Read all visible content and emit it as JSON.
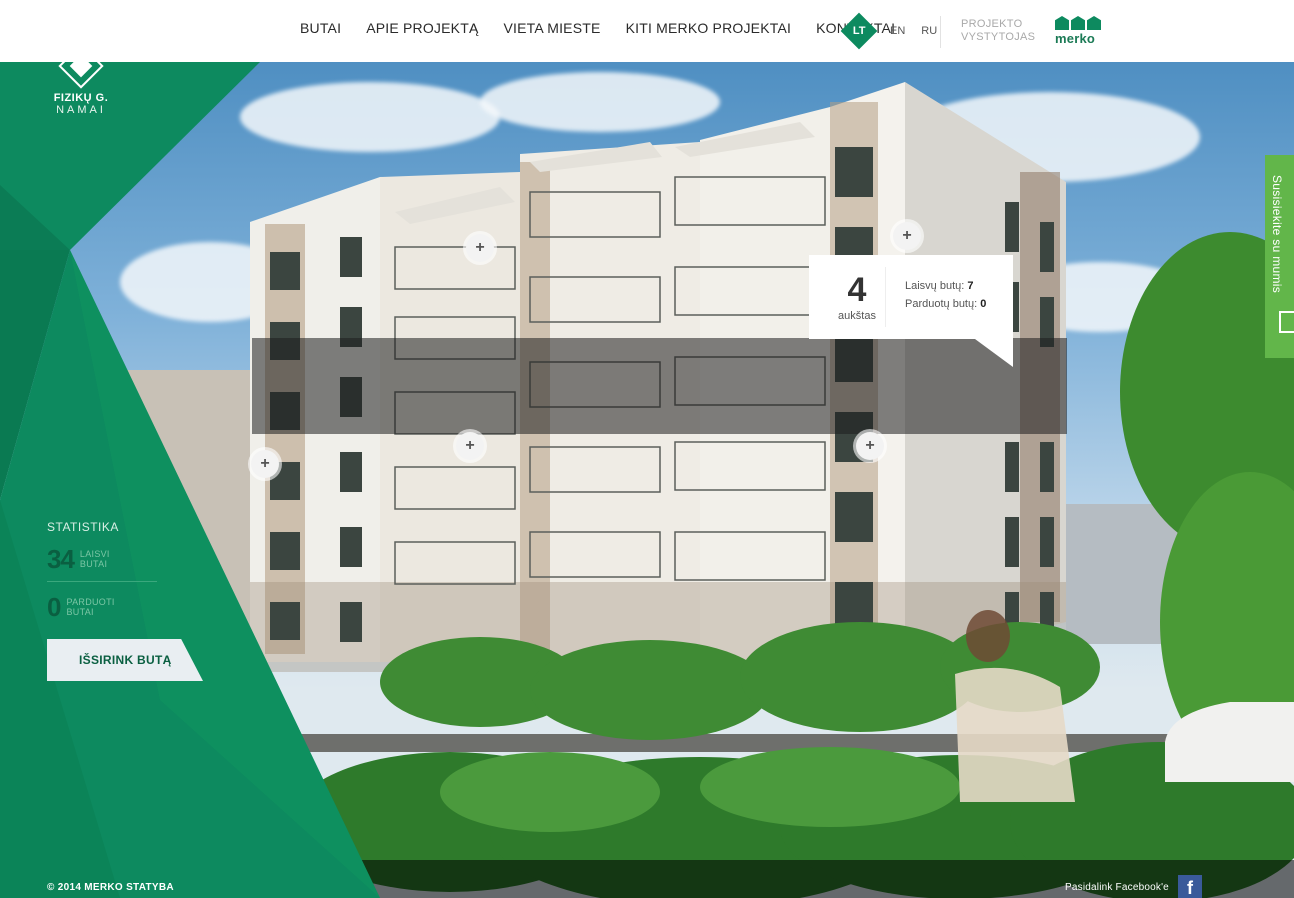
{
  "nav": {
    "items": [
      "BUTAI",
      "APIE PROJEKTĄ",
      "VIETA MIESTE",
      "KITI MERKO PROJEKTAI",
      "KONTAKTAI"
    ],
    "languages": {
      "active": "LT",
      "others": [
        "EN",
        "RU"
      ]
    },
    "developer_label_line1": "PROJEKTO",
    "developer_label_line2": "VYSTYTOJAS",
    "developer_logo_text": "merko"
  },
  "logo": {
    "line1": "FIZIKŲ G.",
    "line2": "NAMAI"
  },
  "stats": {
    "heading": "STATISTIKA",
    "free": {
      "value": "34",
      "label_line1": "LAISVI",
      "label_line2": "BUTAI"
    },
    "sold": {
      "value": "0",
      "label_line1": "PARDUOTI",
      "label_line2": "BUTAI"
    },
    "choose_button": "IŠSIRINK BUTĄ"
  },
  "floor_tooltip": {
    "floor": "4",
    "floor_label": "aukštas",
    "free_label": "Laisvų butų:",
    "free_value": "7",
    "sold_label": "Parduotų butų:",
    "sold_value": "0"
  },
  "contact_tab": "Susisiekite su mumis",
  "footer": {
    "copyright": "© 2014 MERKO STATYBA",
    "facebook_text": "Pasidalink Facebook'e",
    "facebook_icon_glyph": "f"
  },
  "colors": {
    "brand_green": "#0d8a5f",
    "contact_green": "#62b64a",
    "facebook_blue": "#3a5a9a"
  }
}
